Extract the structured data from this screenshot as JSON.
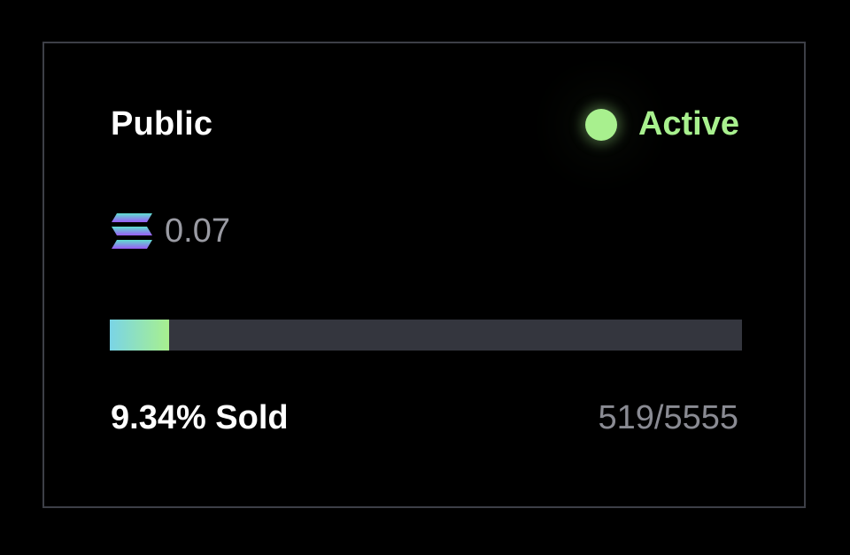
{
  "card": {
    "phase_label": "Public",
    "status": {
      "label": "Active",
      "color": "#a8f08e",
      "icon": "status-dot-icon"
    },
    "price": {
      "icon": "solana-icon",
      "value": "0.07"
    },
    "progress": {
      "fraction": 0.0934,
      "fill_colors": [
        "#7ad4e6",
        "#a8f08e"
      ],
      "track_color": "#34363e"
    },
    "sold_label": "9.34% Sold",
    "sold_count": "519/5555"
  }
}
